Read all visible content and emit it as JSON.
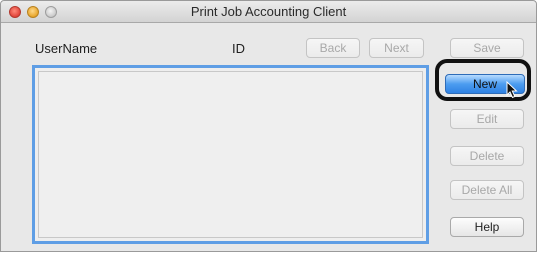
{
  "window": {
    "title": "Print Job Accounting Client"
  },
  "table": {
    "columns": [
      "UserName",
      "ID"
    ]
  },
  "nav": {
    "back": "Back",
    "next": "Next"
  },
  "actions": {
    "save": "Save",
    "new": "New",
    "edit": "Edit",
    "delete": "Delete",
    "delete_all": "Delete All",
    "help": "Help"
  },
  "colors": {
    "accent": "#4c9cf0",
    "focus_ring": "#5f9ee5",
    "highlight": "#111111"
  }
}
